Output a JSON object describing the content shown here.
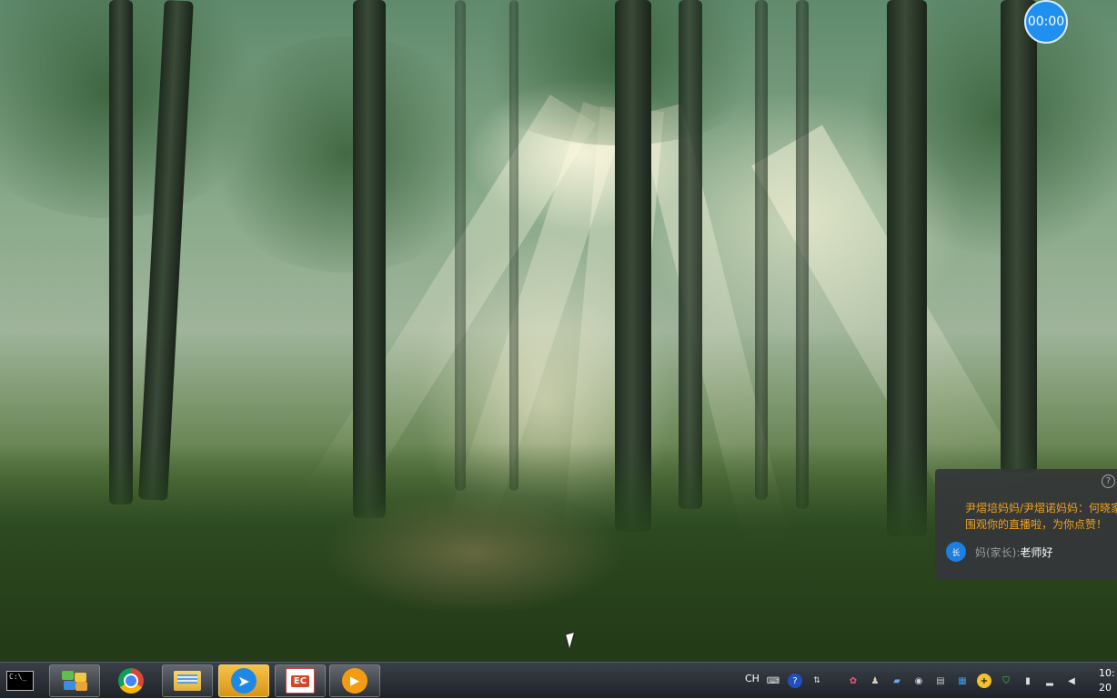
{
  "timer": {
    "text": "00:00"
  },
  "chat_popup": {
    "help_icon": "?",
    "notice": "尹熠培妈妈/尹熠诺妈妈：何晓家\n围观你的直播啦，为你点赞！",
    "role_badge": "长",
    "sender": "妈(家长):",
    "content": "老师好"
  },
  "taskbar": {
    "apps": [
      {
        "name": "cmd",
        "label": "C:\\_"
      },
      {
        "name": "windows-explorer"
      },
      {
        "name": "chrome"
      },
      {
        "name": "file-manager"
      },
      {
        "name": "dingtalk",
        "active": true
      },
      {
        "name": "powerpoint",
        "label": "EC"
      },
      {
        "name": "live-app"
      }
    ],
    "language": "CH",
    "tray_icons": [
      "keyboard-icon",
      "help-icon",
      "input-method-icon",
      "flower-icon",
      "person-icon",
      "network-icon",
      "sync-icon",
      "screen-icon",
      "grid-icon",
      "add-icon",
      "shield-icon",
      "battery-icon",
      "signal-icon",
      "volume-icon"
    ],
    "clock": {
      "time": "10:",
      "date": "20"
    }
  },
  "colors": {
    "timer_bg": "#1f8ff0",
    "notice_text": "#f0a020",
    "popup_bg": "#34363a",
    "active_app": "#f6c248"
  }
}
